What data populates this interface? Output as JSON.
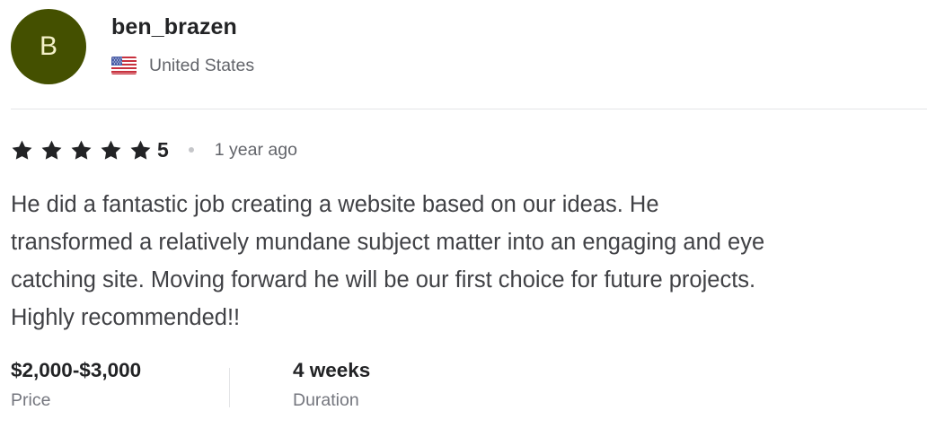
{
  "reviewer": {
    "avatar_initial": "B",
    "avatar_color": "#445000",
    "username": "ben_brazen",
    "country": "United States",
    "flag_icon": "us-flag-icon"
  },
  "rating": {
    "stars": 5,
    "value": "5",
    "time_ago": "1 year ago",
    "star_icon": "star-icon"
  },
  "review": {
    "lines": [
      "He did a fantastic job creating a website based on our ideas. He",
      "transformed a relatively mundane subject matter into an engaging and eye",
      "catching site. Moving forward he will be our first choice for future projects.",
      "Highly recommended!!"
    ]
  },
  "meta": {
    "price_value": "$2,000-$3,000",
    "price_label": "Price",
    "duration_value": "4 weeks",
    "duration_label": "Duration"
  }
}
